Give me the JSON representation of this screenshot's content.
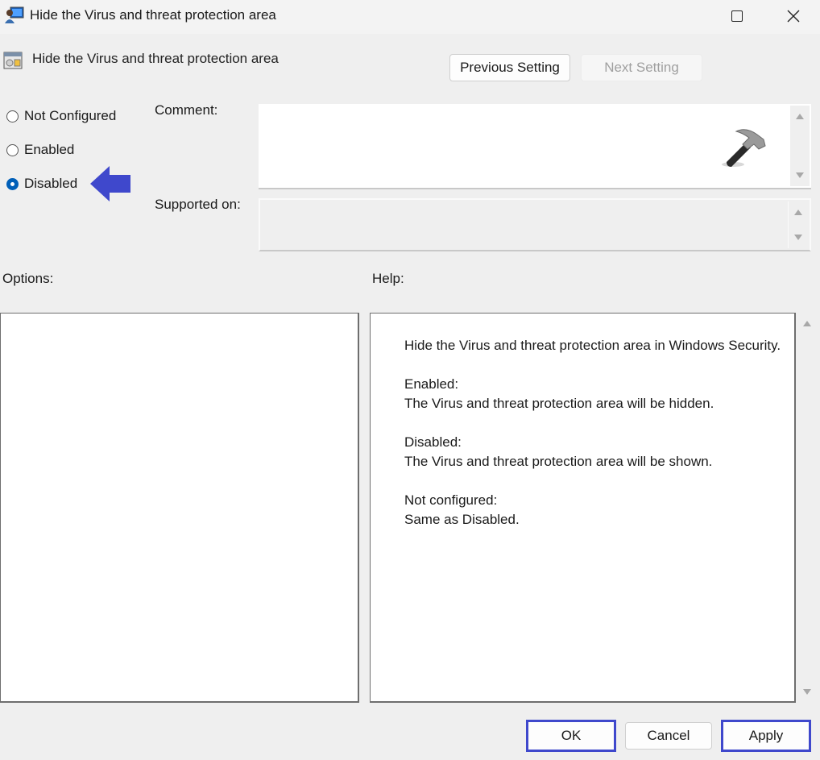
{
  "window": {
    "title": "Hide the Virus and threat protection area",
    "icons": {
      "app": "policy-editor-icon",
      "maximize": "maximize-icon",
      "close": "close-icon"
    }
  },
  "header": {
    "policy_title": "Hide the Virus and threat protection area",
    "policy_icon": "policy-setting-icon",
    "previous_setting_label": "Previous Setting",
    "next_setting_label": "Next Setting",
    "next_setting_enabled": false
  },
  "state": {
    "options": [
      {
        "label": "Not Configured",
        "checked": false
      },
      {
        "label": "Enabled",
        "checked": false
      },
      {
        "label": "Disabled",
        "checked": true
      }
    ],
    "selected": "Disabled",
    "annotation": "arrow-pointing-to-disabled"
  },
  "fields": {
    "comment_label": "Comment:",
    "comment_value": "",
    "supported_label": "Supported on:",
    "supported_value": "",
    "watermark_icon": "hammer-icon"
  },
  "panels": {
    "options_label": "Options:",
    "help_label": "Help:",
    "help": {
      "intro": "Hide the Virus and threat protection area in Windows Security.",
      "enabled_heading": "Enabled:",
      "enabled_text": "The Virus and threat protection area will be hidden.",
      "disabled_heading": "Disabled:",
      "disabled_text": "The Virus and threat protection area will be shown.",
      "notconf_heading": "Not configured:",
      "notconf_text": "Same as Disabled."
    }
  },
  "footer": {
    "ok_label": "OK",
    "cancel_label": "Cancel",
    "apply_label": "Apply",
    "highlight_color": "#3f48cc"
  },
  "colors": {
    "accent": "#005fb8",
    "annotation_arrow": "#3f48cc",
    "background": "#efefef"
  }
}
